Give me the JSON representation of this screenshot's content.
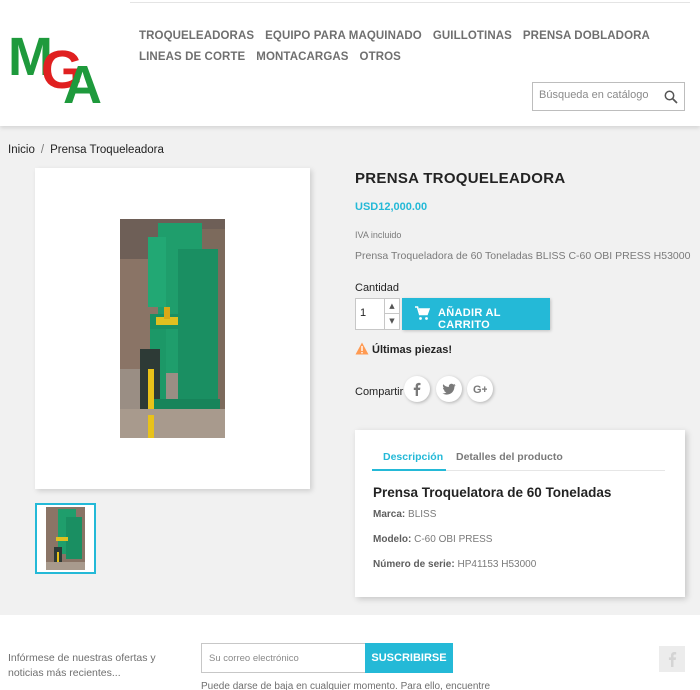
{
  "brand": {
    "logo_text": "MGA",
    "accent": "#24b9d7",
    "logo_colors": [
      "#1e9a3c",
      "#e02020"
    ]
  },
  "nav": {
    "items": [
      {
        "label": "TROQUELEADORAS"
      },
      {
        "label": "EQUIPO PARA MAQUINADO"
      },
      {
        "label": "GUILLOTINAS"
      },
      {
        "label": "PRENSA DOBLADORA"
      },
      {
        "label": "LINEAS DE CORTE"
      },
      {
        "label": "MONTACARGAS"
      },
      {
        "label": "OTROS"
      }
    ]
  },
  "search": {
    "placeholder": "Búsqueda en catálogo",
    "icon": "search-icon"
  },
  "breadcrumb": {
    "home": "Inicio",
    "separator": "/",
    "current": "Prensa Troqueleadora"
  },
  "product": {
    "title": "PRENSA TROQUELEADORA",
    "price": "USD12,000.00",
    "tax_note": "IVA incluido",
    "short_description": "Prensa Troqueladora de 60 Toneladas BLISS C-60 OBI PRESS H53000",
    "quantity_label": "Cantidad",
    "quantity": "1",
    "add_to_cart": "AÑADIR AL CARRITO",
    "stock_notice": "Últimas piezas!",
    "share_label": "Compartir",
    "share_icons": [
      "facebook-icon",
      "twitter-icon",
      "google-plus-icon"
    ]
  },
  "tabs": {
    "items": [
      {
        "label": "Descripción",
        "active": true
      },
      {
        "label": "Detalles del producto",
        "active": false
      }
    ],
    "description": {
      "heading": "Prensa Troquelatora de 60 Toneladas",
      "specs": [
        {
          "label": "Marca:",
          "value": "BLISS"
        },
        {
          "label": "Modelo:",
          "value": "C-60 OBI PRESS"
        },
        {
          "label": "Número de serie:",
          "value": "HP41153 H53000"
        }
      ]
    }
  },
  "footer": {
    "newsletter_text": "Infórmese de nuestras ofertas y noticias más recientes...",
    "email_placeholder": "Su correo electrónico",
    "subscribe_label": "SUSCRIBIRSE",
    "cut_text": "Puede darse de baja en cualquier momento. Para ello, encuentre",
    "social_icon": "facebook-icon"
  }
}
